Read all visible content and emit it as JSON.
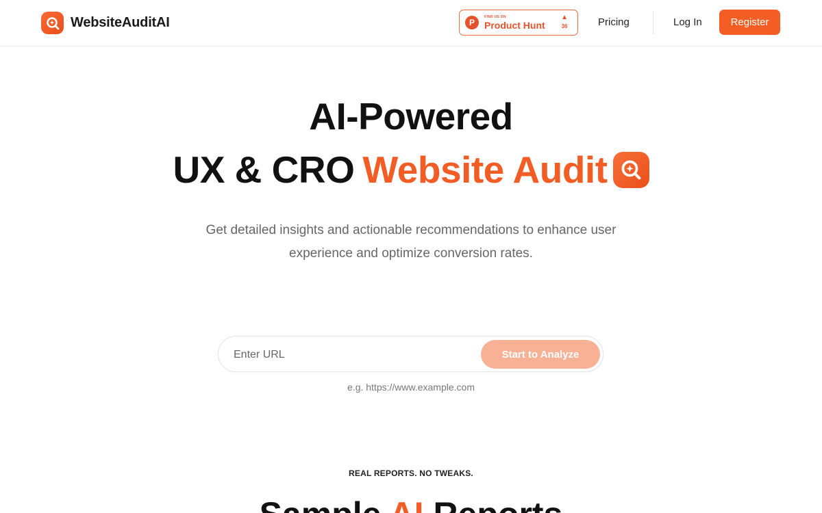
{
  "header": {
    "brand_name": "WebsiteAuditAI",
    "product_hunt": {
      "small_text": "FIND US ON",
      "main_text": "Product Hunt",
      "icon_letter": "P",
      "upvotes": "36"
    },
    "nav": {
      "pricing": "Pricing",
      "login": "Log In",
      "register": "Register"
    }
  },
  "hero": {
    "line1": "AI-Powered",
    "line2_dark": "UX & CRO",
    "line2_accent": "Website Audit",
    "subtitle": "Get detailed insights and actionable recommendations to enhance user experience and optimize conversion rates."
  },
  "url_form": {
    "placeholder": "Enter URL",
    "button": "Start to Analyze",
    "example": "e.g. https://www.example.com"
  },
  "samples": {
    "eyebrow": "REAL REPORTS. NO TWEAKS.",
    "title_before": "Sample ",
    "title_accent": "AI",
    "title_after": " Reports"
  },
  "colors": {
    "accent": "#f45d23",
    "accent_light": "#f9b196",
    "text_dark": "#111111",
    "text_muted": "#666666"
  }
}
